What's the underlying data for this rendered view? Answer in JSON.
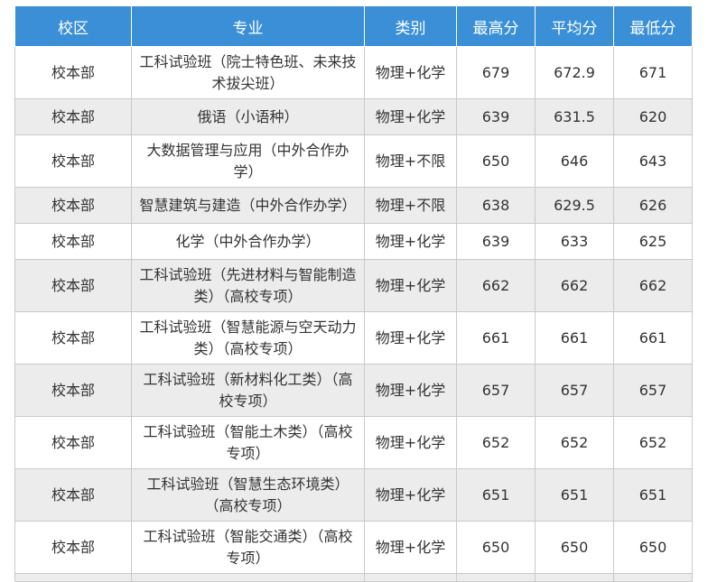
{
  "table": {
    "headers": [
      "校区",
      "专业",
      "类别",
      "最高分",
      "平均分",
      "最低分"
    ],
    "rows": [
      [
        "校本部",
        "工科试验班（院士特色班、未来技术拔尖班）",
        "物理+化学",
        "679",
        "672.9",
        "671"
      ],
      [
        "校本部",
        "俄语（小语种）",
        "物理+化学",
        "639",
        "631.5",
        "620"
      ],
      [
        "校本部",
        "大数据管理与应用（中外合作办学）",
        "物理+不限",
        "650",
        "646",
        "643"
      ],
      [
        "校本部",
        "智慧建筑与建造（中外合作办学）",
        "物理+不限",
        "638",
        "629.5",
        "626"
      ],
      [
        "校本部",
        "化学（中外合作办学）",
        "物理+化学",
        "639",
        "633",
        "625"
      ],
      [
        "校本部",
        "工科试验班（先进材料与智能制造类）（高校专项）",
        "物理+化学",
        "662",
        "662",
        "662"
      ],
      [
        "校本部",
        "工科试验班（智慧能源与空天动力类）（高校专项）",
        "物理+化学",
        "661",
        "661",
        "661"
      ],
      [
        "校本部",
        "工科试验班（新材料化工类）（高校专项）",
        "物理+化学",
        "657",
        "657",
        "657"
      ],
      [
        "校本部",
        "工科试验班（智能土木类）（高校专项）",
        "物理+化学",
        "652",
        "652",
        "652"
      ],
      [
        "校本部",
        "工科试验班（智慧生态环境类）（高校专项）",
        "物理+化学",
        "651",
        "651",
        "651"
      ],
      [
        "校本部",
        "工科试验班（智能交通类）（高校专项）",
        "物理+化学",
        "650",
        "650",
        "650"
      ]
    ]
  }
}
